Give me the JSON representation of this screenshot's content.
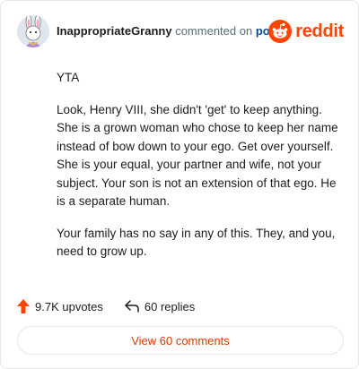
{
  "comment": {
    "author": "InappropriateGranny",
    "action": "commented on",
    "target": "post",
    "paragraphs": [
      "YTA",
      "Look, Henry VIII, she didn't 'get' to keep anything. She is a grown woman who chose to keep her name instead of bow down to your ego. Get over yourself. She is your equal, your partner and wife, not your subject. Your son is not an extension of that ego. He is a separate human.",
      "Your family has no say in any of this. They, and you, need to grow up."
    ]
  },
  "brand": {
    "name": "reddit",
    "icon": "reddit-snoo-icon",
    "color": "#ff4500"
  },
  "footer": {
    "upvotes": "9.7K upvotes",
    "replies": "60 replies",
    "view_comments": "View 60 comments"
  },
  "icons": {
    "upvote": "upvote-arrow-icon",
    "reply": "reply-arrow-icon"
  }
}
